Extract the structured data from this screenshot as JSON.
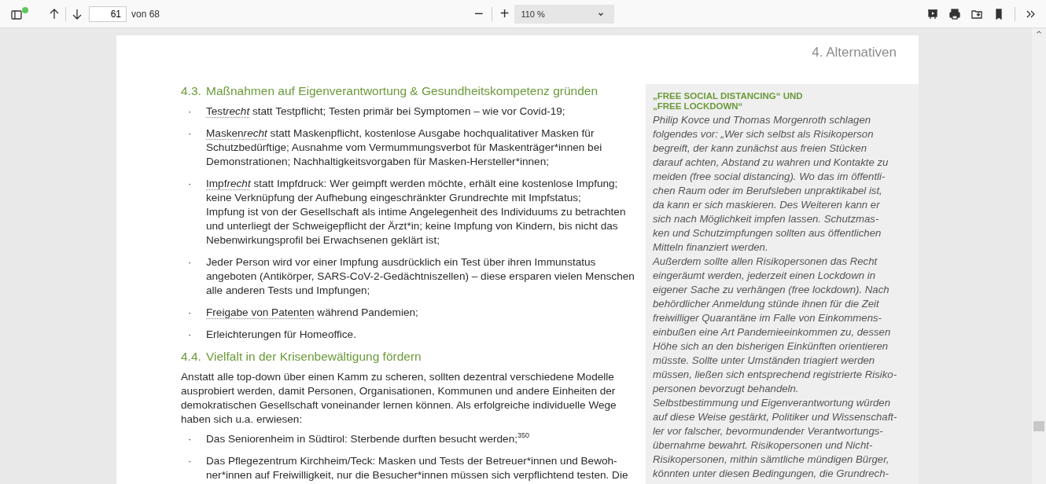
{
  "toolbar": {
    "page_input": "61",
    "page_count": "von 68",
    "zoom_out": "−",
    "zoom_in": "+",
    "zoom_level": "110 %"
  },
  "page": {
    "running_head": "4. Alternativen",
    "sections": [
      {
        "number": "4.3.",
        "title": "Maßnahmen auf Eigenverantwortung & Gesundheitskompetenz gründen",
        "bullets": [
          {
            "marker": "·",
            "link_parts": [
              {
                "text": "Test",
                "italic": false
              },
              {
                "text": "recht",
                "italic": true
              }
            ],
            "text": " statt Testpflicht; Testen primär bei Symptomen – wie vor Covid-19;"
          },
          {
            "marker": "·",
            "link_parts": [
              {
                "text": "Masken",
                "italic": false
              },
              {
                "text": "recht",
                "italic": true
              }
            ],
            "text": " statt Maskenpflicht, kostenlose Ausgabe hochqualitativer Masken für\nSchutzbedürftige; Ausnahme vom Vermummungsverbot für Maskenträger*innen bei\nDemonstrationen; Nachhaltigkeitsvorgaben für Masken-Hersteller*innen;"
          },
          {
            "marker": "·",
            "link_parts": [
              {
                "text": "Impf",
                "italic": false
              },
              {
                "text": "recht",
                "italic": true
              }
            ],
            "text": " statt Impfdruck: Wer geimpft werden möchte, erhält eine kostenlose Impfung;\nkeine Verknüpfung der Aufhebung eingeschränkter Grundrechte mit Impfstatus;\nImpfung ist von der Gesellschaft als intime Angelegenheit des Individuums zu betrachten\nund unterliegt der Schweigepflicht der Ärzt*in; keine Impfung von Kindern, bis nicht das\nNebenwirkungsprofil bei Erwachsenen geklärt ist;"
          },
          {
            "marker": "·",
            "text": "Jeder Person wird vor einer Impfung ausdrücklich ein Test über ihren Immunstatus\nangeboten (Antikörper, SARS-CoV-2-Gedächtniszellen) – diese ersparen vielen Menschen\nalle anderen Tests und Impfungen;"
          },
          {
            "marker": "·",
            "link_parts": [
              {
                "text": "Freigabe von Patenten",
                "italic": false
              }
            ],
            "text": " während Pandemien;"
          },
          {
            "marker": "·",
            "text": "Erleichterungen für Homeoffice."
          }
        ]
      },
      {
        "number": "4.4.",
        "title": "Vielfalt in der Krisenbewältigung fördern",
        "intro": "Anstatt alle top-down über einen Kamm zu scheren, sollten dezentral verschiedene Modelle\nausprobiert werden, damit Personen, Organisationen, Kommunen und andere Einheiten der\ndemokratischen Gesellschaft voneinander lernen können. Als erfolgreiche individuelle Wege\nhaben sich u.a. erwiesen:",
        "bullets": [
          {
            "marker": "·",
            "text": "Das Seniorenheim in Südtirol: Sterbende durften besucht werden;$^{350}$"
          },
          {
            "marker": "·",
            "text": "Das Pflegezentrum Kirchheim/Teck: Masken und Tests der Betreuer*innen und Bewoh-\nner*innen auf Freiwilligkeit, nur die Besucher*innen müssen sich verpflichtend testen. Die"
          }
        ]
      }
    ],
    "sidebar": {
      "title": "„FREE SOCIAL DISTANCING“ UND\n„FREE LOCKDOWN“",
      "paragraphs": [
        "Philip Kovce und Thomas Morgenroth schlagen\nfolgendes vor: „Wer sich selbst als Risikoperson\nbegreift, der kann zunächst aus freien Stücken\ndarauf achten, Abstand zu wahren und Kontakte zu\nmeiden (free social distancing). Wo das im öffentli-\nchen Raum oder im Berufsleben unpraktikabel ist,\nda kann er sich maskieren. Des Weiteren kann er\nsich nach Möglichkeit impfen lassen. Schutzmas-\nken und Schutzimpfungen sollten aus öffentlichen\nMitteln finanziert werden.",
        "Außerdem sollte allen Risikopersonen das Recht\neingeräumt werden, jederzeit einen Lockdown in\neigener Sache zu verhängen (free lockdown). Nach\nbehördlicher Anmeldung stünde ihnen für die Zeit\nfreiwilliger Quarantäne im Falle von Einkommens-\neinbußen eine Art Pandemieeinkommen zu, dessen\nHöhe sich an den bisherigen Einkünften orientieren\nmüsste. Sollte unter Umständen triagiert werden\nmüssen, ließen sich entsprechend registrierte Risiko-\npersonen bevorzugt behandeln.",
        "Selbstbestimmung und Eigenverantwortung würden\nauf diese Weise gestärkt, Politiker und Wissenschaft-\nler vor falscher, bevormundender Verantwortungs-\nübernahme bewahrt. Risikopersonen und Nicht-\nRisikopersonen, mithin sämtliche mündigen Bürger,\nkönnten unter diesen Bedingungen, die Grundrech-"
      ]
    }
  }
}
